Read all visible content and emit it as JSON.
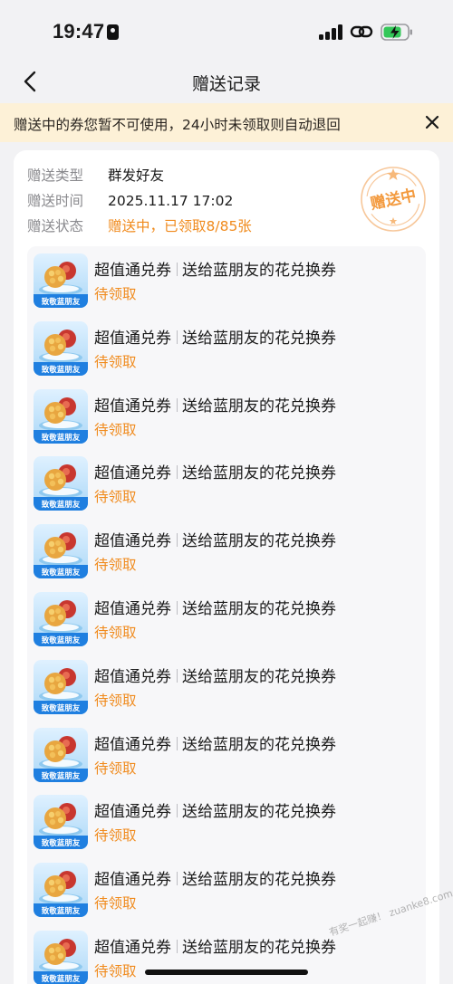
{
  "status_bar": {
    "time": "19:47"
  },
  "header": {
    "title": "赠送记录"
  },
  "notice": {
    "text": "赠送中的券您暂不可使用，24小时未领取则自动退回"
  },
  "record": {
    "rows": [
      {
        "label": "赠送类型",
        "value": "群发好友"
      },
      {
        "label": "赠送时间",
        "value": "2025.11.17 17:02"
      },
      {
        "label": "赠送状态",
        "value": "赠送中，已领取8/85张"
      }
    ],
    "stamp_text": "赠送中"
  },
  "coupons": [
    {
      "name": "超值通兑券",
      "desc": "送给蓝朋友的花兑换券",
      "status": "待领取",
      "thumb_label": "致敬蓝朋友"
    },
    {
      "name": "超值通兑券",
      "desc": "送给蓝朋友的花兑换券",
      "status": "待领取",
      "thumb_label": "致敬蓝朋友"
    },
    {
      "name": "超值通兑券",
      "desc": "送给蓝朋友的花兑换券",
      "status": "待领取",
      "thumb_label": "致敬蓝朋友"
    },
    {
      "name": "超值通兑券",
      "desc": "送给蓝朋友的花兑换券",
      "status": "待领取",
      "thumb_label": "致敬蓝朋友"
    },
    {
      "name": "超值通兑券",
      "desc": "送给蓝朋友的花兑换券",
      "status": "待领取",
      "thumb_label": "致敬蓝朋友"
    },
    {
      "name": "超值通兑券",
      "desc": "送给蓝朋友的花兑换券",
      "status": "待领取",
      "thumb_label": "致敬蓝朋友"
    },
    {
      "name": "超值通兑券",
      "desc": "送给蓝朋友的花兑换券",
      "status": "待领取",
      "thumb_label": "致敬蓝朋友"
    },
    {
      "name": "超值通兑券",
      "desc": "送给蓝朋友的花兑换券",
      "status": "待领取",
      "thumb_label": "致敬蓝朋友"
    },
    {
      "name": "超值通兑券",
      "desc": "送给蓝朋友的花兑换券",
      "status": "待领取",
      "thumb_label": "致敬蓝朋友"
    },
    {
      "name": "超值通兑券",
      "desc": "送给蓝朋友的花兑换券",
      "status": "待领取",
      "thumb_label": "致敬蓝朋友"
    },
    {
      "name": "超值通兑券",
      "desc": "送给蓝朋友的花兑换券",
      "status": "待领取",
      "thumb_label": "致敬蓝朋友"
    }
  ],
  "watermark": "有奖一起赚！ zuanke8.com",
  "colors": {
    "accent_orange": "#f08a1c",
    "notice_bg": "#fdf1d7",
    "page_bg": "#f2f2f4",
    "thumb_blue": "#1f7fe0",
    "battery_green": "#34c759"
  },
  "icons": {
    "back": "chevron-left-icon",
    "close": "close-icon",
    "signal": "cellular-signal-icon",
    "link": "link-icon",
    "battery": "battery-charging-icon",
    "focus": "focus-mode-icon"
  }
}
